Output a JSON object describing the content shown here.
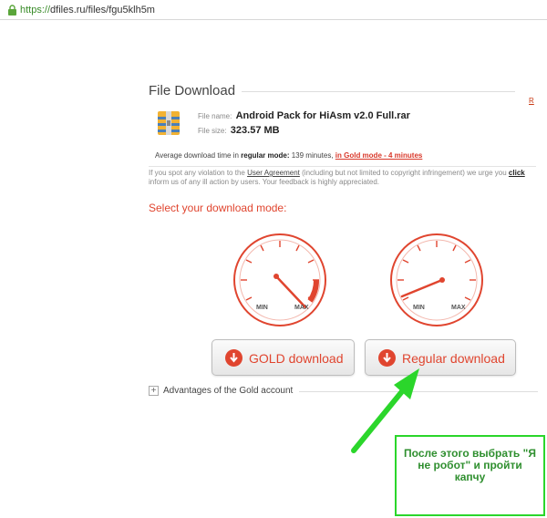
{
  "browser": {
    "url_scheme": "https://",
    "url_rest": "dfiles.ru/files/fgu5klh5m"
  },
  "page": {
    "title": "File Download",
    "corner_link": "R"
  },
  "file": {
    "name_label": "File name:",
    "name": "Android Pack for HiAsm v2.0 Full.rar",
    "size_label": "File size:",
    "size": "323.57 MB"
  },
  "download_time": {
    "prefix": "Average download time in",
    "mode": "regular mode:",
    "regular": "139 minutes,",
    "gold": "in Gold mode - 4 minutes"
  },
  "notice": {
    "line1_prefix": "If you spot any violation to the",
    "agreement_link": "User Agreement",
    "line1_suffix": "(including but not limited to copyright infringement) we urge you",
    "click_link": "click",
    "line2": "inform us of any ill action by users. Your feedback is highly appreciated."
  },
  "modes": {
    "title": "Select your download mode:",
    "gauge_min": "MIN",
    "gauge_max": "MAX",
    "gold_label": "GOLD download",
    "regular_label": "Regular download"
  },
  "advantages": {
    "toggle": "+",
    "label": "Advantages of the Gold account"
  },
  "annotation": {
    "text": "После этого выбрать \"Я не робот\" и пройти капчу"
  },
  "colors": {
    "accent": "#e0452f",
    "annotation_green": "#2bd62b"
  }
}
